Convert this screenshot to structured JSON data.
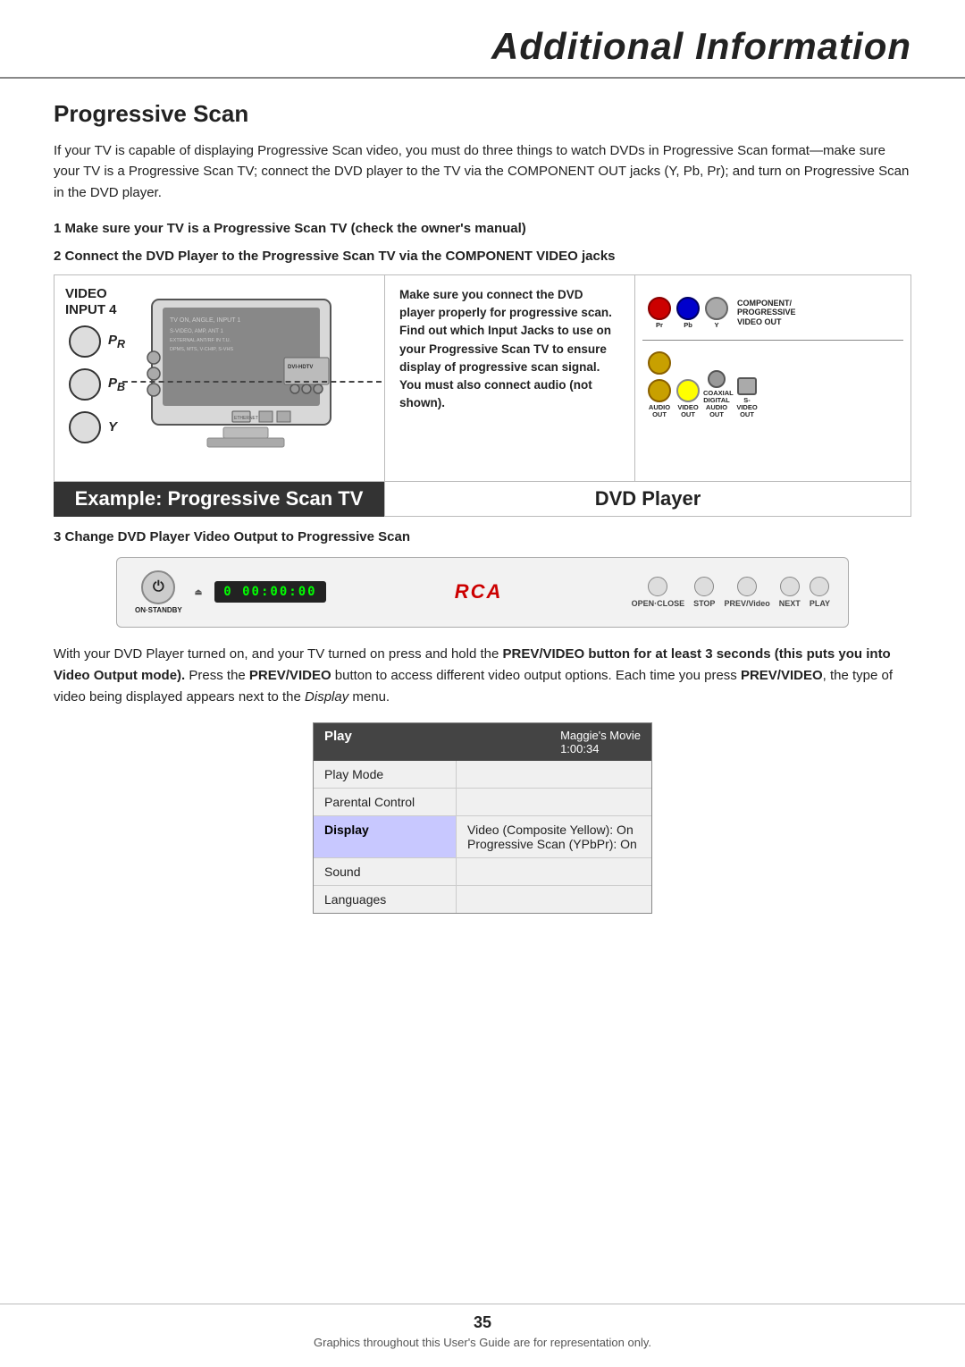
{
  "header": {
    "title": "Additional Information"
  },
  "section1": {
    "title": "Progressive Scan",
    "intro": "If your TV is capable of displaying Progressive Scan video, you must do three things to watch DVDs in Progressive Scan format—make sure your TV is a Progressive Scan TV; connect the DVD player to the TV via the COMPONENT OUT jacks (Y, Pb, Pr); and turn on Progressive Scan in the DVD player.",
    "step1": "1  Make sure your TV is a Progressive Scan TV (check the owner's manual)",
    "step2": "2  Connect the DVD Player to the Progressive Scan TV via the COMPONENT VIDEO jacks",
    "diagram": {
      "tv_label": "VIDEO\nINPUT 4",
      "connectors": [
        "Pr",
        "Pb",
        "Y"
      ],
      "caption_lines": [
        "Make sure you connect the DVD",
        "player properly for progressive scan.",
        "Find out which Input Jacks to use",
        "on your Progressive Scan TV to",
        "ensure display of progressive scan",
        "signal. You must also connect audio",
        "(not shown)."
      ],
      "dvd_port_labels": [
        "Pr",
        "Pb",
        "Y"
      ],
      "dvd_section_label": "COMPONENT/\nPROGRESSIVE\nVIDEO OUT",
      "bottom_ports": [
        "AUDIO OUT",
        "VIDEO\nOUT",
        "COAXIAL\nDIGITAL\nAUDIO OUT",
        "S-VIDEO\nOUT"
      ]
    },
    "label_tv": "Example: Progressive Scan TV",
    "label_dvd": "DVD Player",
    "step3": "3  Change DVD Player Video Output to Progressive Scan",
    "panel": {
      "power_label": "ON·STANDBY",
      "display": "0 00:00:00",
      "logo": "RCA",
      "buttons": [
        "OPEN·CLOSE",
        "STOP",
        "PREV/Video",
        "NEXT",
        "PLAY"
      ]
    },
    "body_text1": "With your DVD Player turned on, and your TV turned on press and hold the ",
    "body_bold1": "PREV/VIDEO",
    "body_text2": " button for at least 3 seconds (this puts you into Video Output mode).",
    "body_text3": " Press the ",
    "body_bold2": "PREV/VIDEO",
    "body_text4": " button to access different video output options. Each time you press ",
    "body_bold3": "PREV/VIDEO",
    "body_text5": ", the type of video being displayed appears next to the ",
    "body_italic": "Display",
    "body_text6": " menu.",
    "menu": {
      "header_left": "Play",
      "header_right": "Maggie's Movie\n1:00:34",
      "items": [
        {
          "label": "Play Mode",
          "value": ""
        },
        {
          "label": "Parental Control",
          "value": ""
        },
        {
          "label": "Display",
          "value": "Video (Composite Yellow): On\nProgressive Scan (YPbPr): On"
        },
        {
          "label": "Sound",
          "value": ""
        },
        {
          "label": "Languages",
          "value": ""
        }
      ]
    }
  },
  "footer": {
    "page_number": "35",
    "note": "Graphics throughout this User's Guide are for representation only."
  }
}
